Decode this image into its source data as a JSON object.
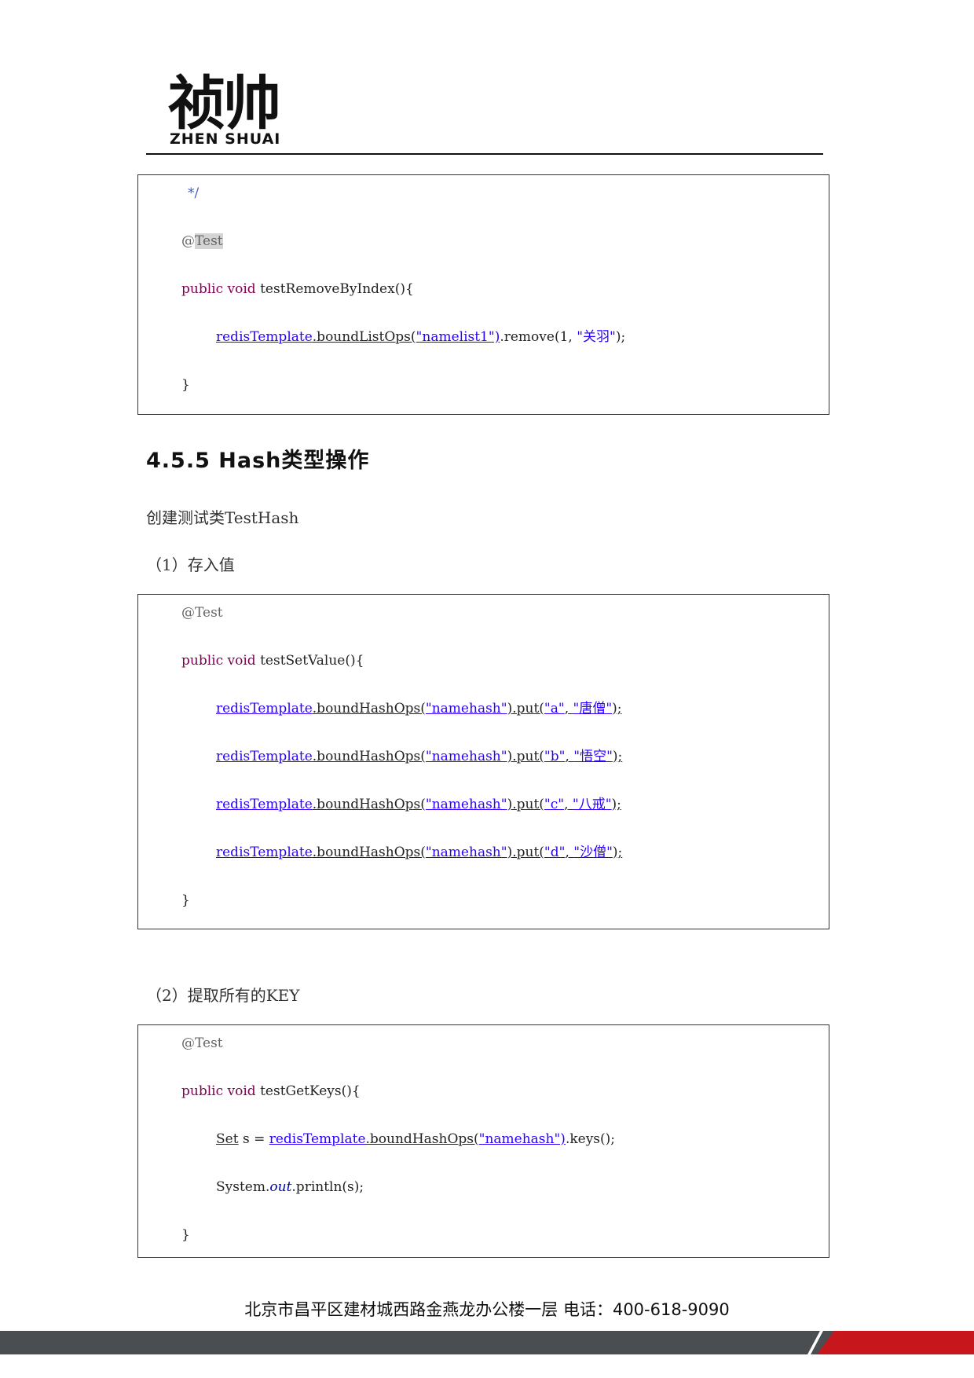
{
  "header": {
    "logo_cn": "祯帅",
    "logo_en": "ZHEN SHUAI"
  },
  "section": {
    "heading": "4.5.5 Hash类型操作",
    "intro": "创建测试类TestHash",
    "step1": "（1）存入值",
    "step2": "（2）提取所有的KEY"
  },
  "code1": {
    "comment_end": "*/",
    "annotation": "@",
    "annotation_name": "Test",
    "sig_kw": "public void",
    "sig_rest": " testRemoveByIndex(){",
    "body_obj": "redisTemplate",
    "body_call": ".boundListOps(",
    "body_str": "\"namelist1\")",
    "body_rest1": ".remove(1, ",
    "body_str2": "\"关羽\"",
    "body_rest2": ");",
    "close": "}"
  },
  "code2": {
    "annotation": "@Test",
    "sig_kw": "public void",
    "sig_rest": " testSetValue(){",
    "lines": [
      {
        "obj": "redisTemplate",
        "call": ".boundHashOps(",
        "key": "\"namehash\"",
        "mid": ").put(",
        "k": "\"a\"",
        "comma": ", ",
        "v": "\"唐僧\"",
        "end": ");"
      },
      {
        "obj": "redisTemplate",
        "call": ".boundHashOps(",
        "key": "\"namehash\"",
        "mid": ").put(",
        "k": "\"b\"",
        "comma": ", ",
        "v": "\"悟空\"",
        "end": ");"
      },
      {
        "obj": "redisTemplate",
        "call": ".boundHashOps(",
        "key": "\"namehash\"",
        "mid": ").put(",
        "k": "\"c\"",
        "comma": ", ",
        "v": "\"八戒\"",
        "end": ");"
      },
      {
        "obj": "redisTemplate",
        "call": ".boundHashOps(",
        "key": "\"namehash\"",
        "mid": ").put(",
        "k": "\"d\"",
        "comma": ", ",
        "v": "\"沙僧\"",
        "end": ");"
      }
    ],
    "close": "}"
  },
  "code3": {
    "annotation": "@Test",
    "sig_kw": "public void",
    "sig_rest": " testGetKeys(){",
    "l1_type": "Set",
    "l1_var": " s = ",
    "l1_obj": "redisTemplate",
    "l1_call": ".boundHashOps(",
    "l1_str": "\"namehash\")",
    "l1_end": ".keys();",
    "l2_sys": "System.",
    "l2_out": "out",
    "l2_end": ".println(s);",
    "close": "}"
  },
  "footer": {
    "address": "北京市昌平区建材城西路金燕龙办公楼一层   电话：400-618-9090"
  }
}
